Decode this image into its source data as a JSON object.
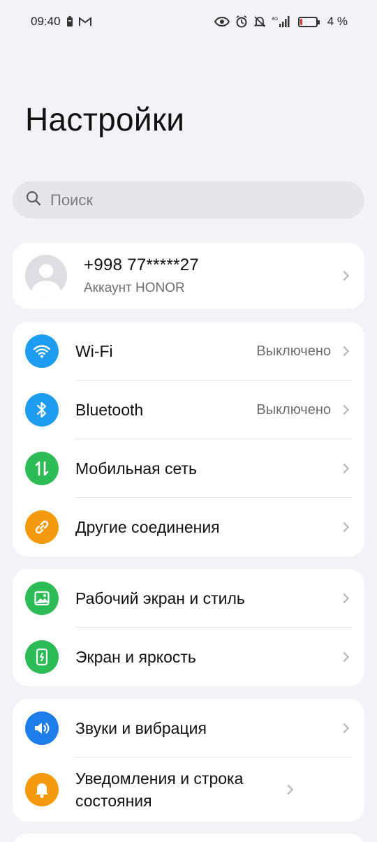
{
  "status_bar": {
    "time": "09:40",
    "battery_text": "4 %",
    "network_label": "4G",
    "icons": [
      "battery-saver-icon",
      "gmail-icon",
      "eye-icon",
      "alarm-icon",
      "mute-icon",
      "signal-icon",
      "battery-icon"
    ]
  },
  "title": "Настройки",
  "search": {
    "placeholder": "Поиск"
  },
  "account": {
    "phone": "+998 77*****27",
    "subtitle": "Аккаунт HONOR"
  },
  "groups": [
    {
      "items": [
        {
          "label": "Wi-Fi",
          "value": "Выключено",
          "icon": "wifi-icon",
          "color": "#1e9cf0"
        },
        {
          "label": "Bluetooth",
          "value": "Выключено",
          "icon": "bluetooth-icon",
          "color": "#1e9cf0"
        },
        {
          "label": "Мобильная сеть",
          "value": "",
          "icon": "mobile-network-icon",
          "color": "#2dbb55"
        },
        {
          "label": "Другие соединения",
          "value": "",
          "icon": "link-icon",
          "color": "#f59a0c"
        }
      ]
    },
    {
      "items": [
        {
          "label": "Рабочий экран и стиль",
          "icon": "image-icon",
          "color": "#2dbb55"
        },
        {
          "label": "Экран и яркость",
          "icon": "brightness-icon",
          "color": "#2dbb55"
        }
      ]
    },
    {
      "items": [
        {
          "label": "Звуки и вибрация",
          "icon": "speaker-icon",
          "color": "#1e7de8"
        },
        {
          "label": "Уведомления и строка состояния",
          "icon": "bell-icon",
          "color": "#f59a0c"
        }
      ]
    }
  ]
}
